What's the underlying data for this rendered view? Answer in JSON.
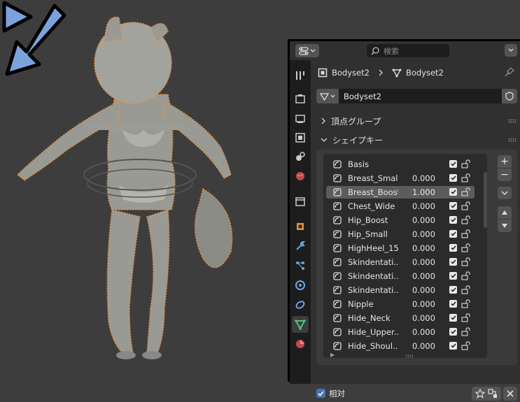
{
  "header": {
    "search_placeholder": "検索"
  },
  "breadcrumb": {
    "object_name": "Bodyset2",
    "mesh_name": "Bodyset2"
  },
  "datablock": {
    "name": "Bodyset2"
  },
  "panels": {
    "vertex_groups": "頂点グループ",
    "shape_keys": "シェイプキー"
  },
  "shape_keys": [
    {
      "name": "Basis",
      "value": ""
    },
    {
      "name": "Breast_Small",
      "value": "0.000"
    },
    {
      "name": "Breast_Boost",
      "value": "1.000"
    },
    {
      "name": "Chest_Wide",
      "value": "0.000"
    },
    {
      "name": "Hip_Boost",
      "value": "0.000"
    },
    {
      "name": "Hip_Small",
      "value": "0.000"
    },
    {
      "name": "HighHeel_15",
      "value": "0.000"
    },
    {
      "name": "Skindentati...",
      "value": "0.000"
    },
    {
      "name": "Skindentati...",
      "value": "0.000"
    },
    {
      "name": "Skindentati...",
      "value": "0.000"
    },
    {
      "name": "Nipple",
      "value": "0.000"
    },
    {
      "name": "Hide_Neck",
      "value": "0.000"
    },
    {
      "name": "Hide_Upper...",
      "value": "0.000"
    },
    {
      "name": "Hide_Shoul...",
      "value": "0.000"
    }
  ],
  "active_shape_key_index": 2,
  "footer": {
    "relative_label": "相対"
  },
  "side_buttons": {
    "add": "+",
    "remove": "−"
  },
  "colors": {
    "annotation_arrow_fill": "#7ba3db",
    "annotation_arrow_stroke": "#000000",
    "selection_outline": "#e8903a",
    "active_tab_icon": "#4fc27a"
  }
}
